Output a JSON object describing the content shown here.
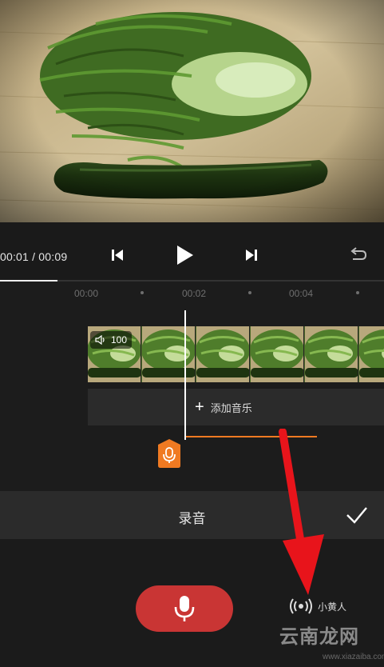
{
  "player": {
    "time_display": "00:01 / 00:09",
    "progress": 0.15,
    "icons": {
      "prev": "skip-previous-icon",
      "play": "play-icon",
      "next": "skip-next-icon",
      "undo": "undo-icon"
    }
  },
  "timeline": {
    "ruler": [
      "00:00",
      "00:02",
      "00:04"
    ],
    "clip": {
      "volume": "100",
      "icon": "speaker-icon"
    },
    "add_music_label": "添加音乐",
    "recording_marker_icon": "microphone-icon"
  },
  "record_panel": {
    "title": "录音",
    "confirm_icon": "check-icon",
    "mic_icon": "microphone-icon",
    "voice_effect_label": "小黄人",
    "voice_effect_icon": "broadcast-icon"
  },
  "watermark": {
    "main": "云南龙网",
    "sub": "www.xiazaiba.com"
  },
  "colors": {
    "accent_orange": "#f07a22",
    "record_red": "#c93534",
    "annotation_red": "#e8141b"
  }
}
